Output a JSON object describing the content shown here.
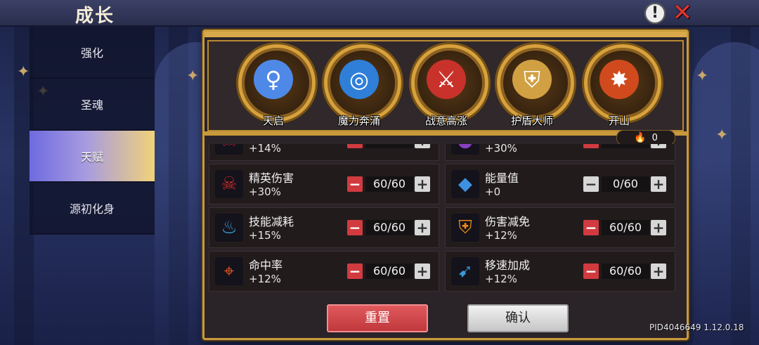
{
  "header": {
    "title": "成长"
  },
  "side_menu": {
    "items": [
      {
        "label": "强化"
      },
      {
        "label": "圣魂"
      },
      {
        "label": "天赋"
      },
      {
        "label": "源初化身"
      }
    ],
    "active_index": 2
  },
  "talents": [
    {
      "label": "天启",
      "icon": "figure-icon",
      "glyph": "♀",
      "color": "#4f89e8"
    },
    {
      "label": "魔力奔涌",
      "icon": "swirl-icon",
      "glyph": "◎",
      "color": "#2f7fd8"
    },
    {
      "label": "战意高涨",
      "icon": "warrior-icon",
      "glyph": "⚔",
      "color": "#c8322a"
    },
    {
      "label": "护盾大师",
      "icon": "shield-icon",
      "glyph": "⛨",
      "color": "#d0a043"
    },
    {
      "label": "开山",
      "icon": "burst-icon",
      "glyph": "✸",
      "color": "#d04a1e"
    }
  ],
  "fire_counter": {
    "value": "0"
  },
  "stats": [
    {
      "name": "",
      "value": "+14%",
      "count": "",
      "icon": "demon-icon",
      "glyph": "☠",
      "color": "#b0223a"
    },
    {
      "name": "",
      "value": "+30%",
      "count": "",
      "icon": "orb-icon",
      "glyph": "●",
      "color": "#8a3fc1"
    },
    {
      "name": "精英伤害",
      "value": "+30%",
      "count": "60/60",
      "icon": "demon-skull-icon",
      "glyph": "☠",
      "color": "#c12a2a"
    },
    {
      "name": "能量值",
      "value": "+0",
      "count": "0/60",
      "icon": "water-drop-icon",
      "glyph": "💧",
      "color": "#3e90e0"
    },
    {
      "name": "技能减耗",
      "value": "+15%",
      "count": "60/60",
      "icon": "blue-flame-icon",
      "glyph": "♨",
      "color": "#3aa7e6"
    },
    {
      "name": "伤害减免",
      "value": "+12%",
      "count": "60/60",
      "icon": "shield-icon",
      "glyph": "⛨",
      "color": "#e58a1e"
    },
    {
      "name": "命中率",
      "value": "+12%",
      "count": "60/60",
      "icon": "crosshair-icon",
      "glyph": "⌖",
      "color": "#e8561c"
    },
    {
      "name": "移速加成",
      "value": "+12%",
      "count": "60/60",
      "icon": "boot-icon",
      "glyph": "➹",
      "color": "#3a9ad6"
    }
  ],
  "buttons": {
    "reset": "重置",
    "confirm": "确认"
  },
  "version": "PID4046649 1.12.0.18"
}
